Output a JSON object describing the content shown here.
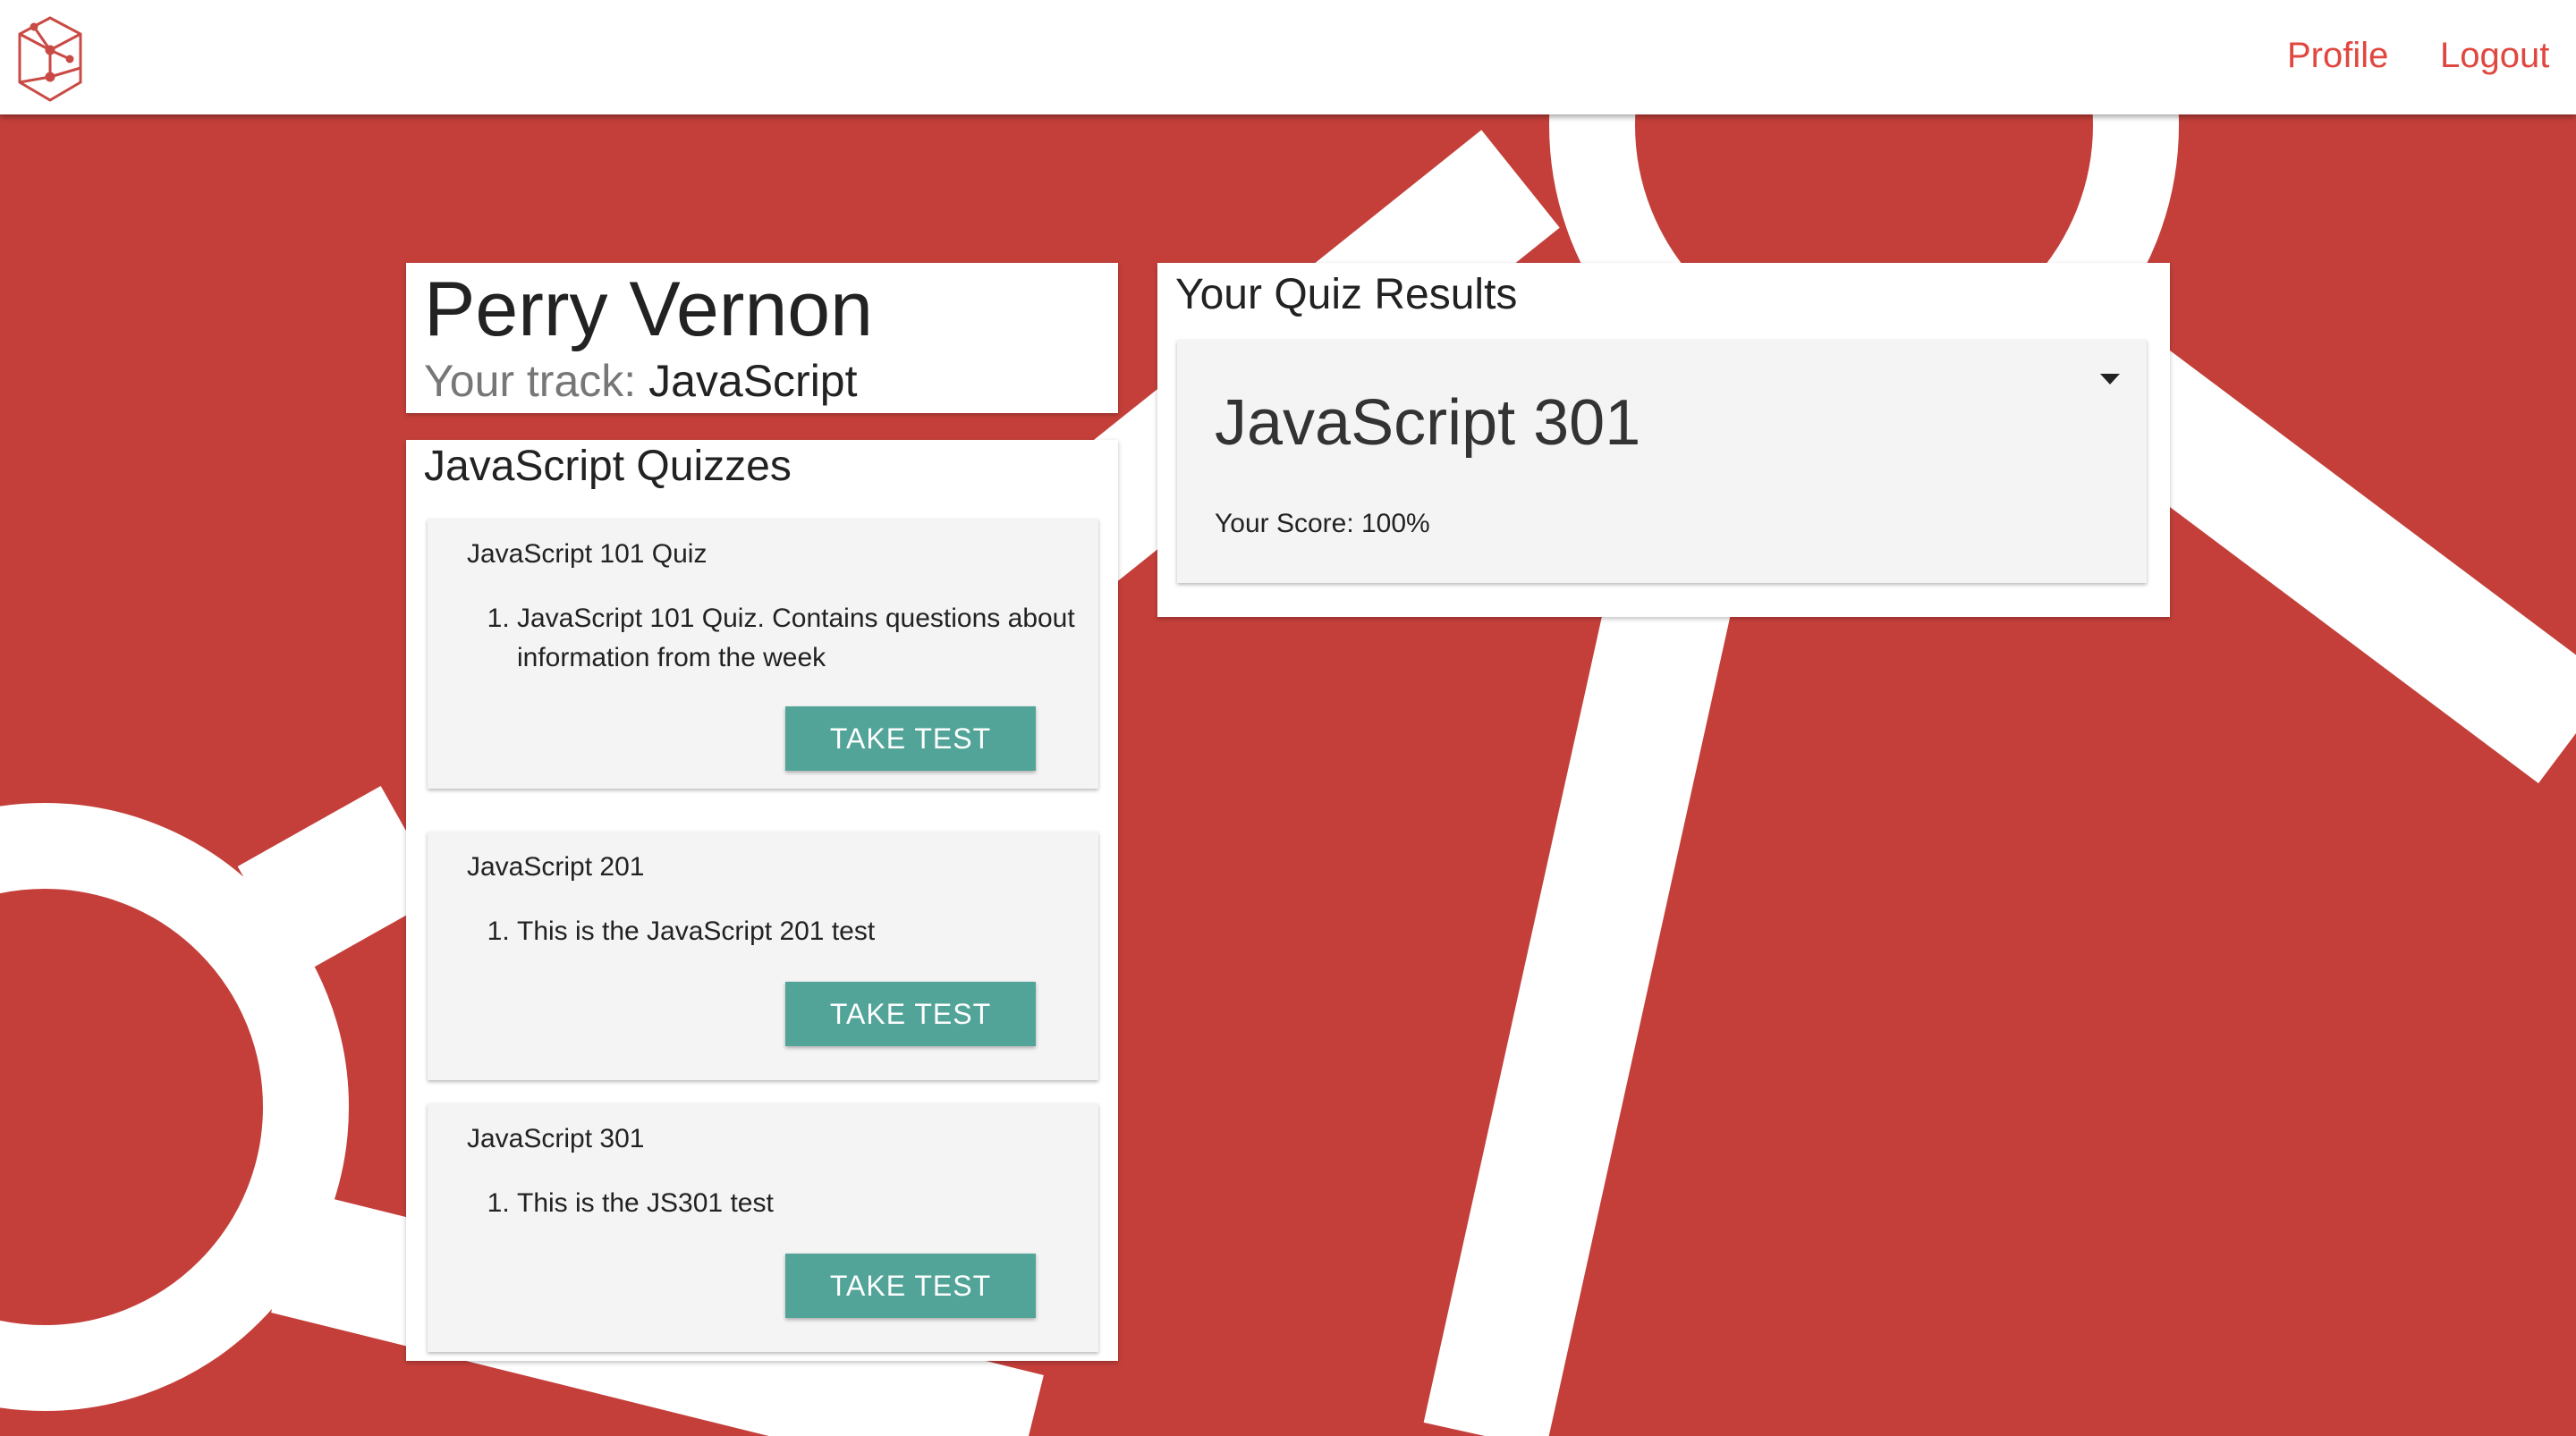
{
  "nav": {
    "profile_label": "Profile",
    "logout_label": "Logout",
    "link_color": "#e0473f"
  },
  "theme": {
    "background": "#c43f3a",
    "button_color": "#52a499"
  },
  "user": {
    "name": "Perry Vernon",
    "track_label": "Your track:",
    "track_value": "JavaScript"
  },
  "quizzes": {
    "title": "JavaScript Quizzes",
    "items": [
      {
        "name": "JavaScript 101 Quiz",
        "description": "JavaScript 101 Quiz. Contains questions about information from the week",
        "button_label": "TAKE TEST"
      },
      {
        "name": "JavaScript 201",
        "description": "This is the JavaScript 201 test",
        "button_label": "TAKE TEST"
      },
      {
        "name": "JavaScript 301",
        "description": "This is the JS301 test",
        "button_label": "TAKE TEST"
      }
    ]
  },
  "results": {
    "title": "Your Quiz Results",
    "items": [
      {
        "quiz_name": "JavaScript 301",
        "score_text": "Your Score: 100%",
        "icon": "caret-down-icon"
      }
    ]
  }
}
